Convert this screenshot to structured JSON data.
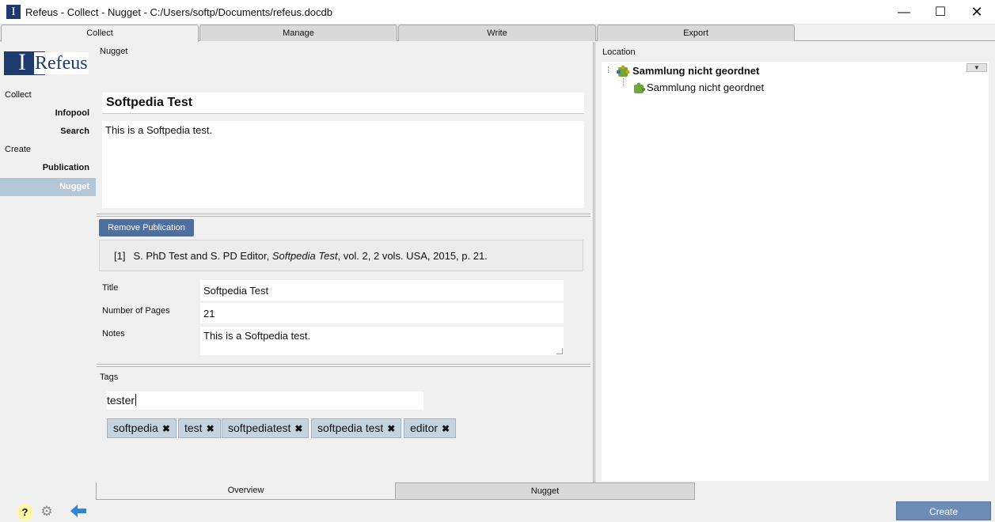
{
  "window": {
    "title": "Refeus - Collect - Nugget - C:/Users/softp/Documents/refeus.docdb",
    "app_icon": "I",
    "min_symbol": "—",
    "max_symbol": "☐",
    "close_symbol": "✕"
  },
  "top_tabs": [
    "Collect",
    "Manage",
    "Write",
    "Export"
  ],
  "logo": {
    "mark": "I",
    "word": "Refeus"
  },
  "nav": {
    "collect_label": "Collect",
    "infopool": "Infopool",
    "search": "Search",
    "create_label": "Create",
    "publication": "Publication",
    "nugget": "Nugget"
  },
  "nugget": {
    "section_label": "Nugget",
    "title": "Softpedia Test",
    "body": "This is a Softpedia test."
  },
  "publication": {
    "remove_button": "Remove Publication",
    "citation": {
      "num": "[1]",
      "pre": "S. PhD Test and S. PD Editor, ",
      "italic": "Softpedia Test",
      "post": ", vol. 2, 2 vols. USA, 2015, p. 21."
    },
    "fields": {
      "title_label": "Title",
      "title_value": "Softpedia Test",
      "pages_label": "Number of Pages",
      "pages_value": "21",
      "notes_label": "Notes",
      "notes_value": "This is a Softpedia test."
    }
  },
  "tags": {
    "label": "Tags",
    "input_value": "tester",
    "items": [
      "softpedia",
      "test",
      "softpediatest",
      "softpedia test",
      "editor"
    ],
    "remove_symbol": "✖"
  },
  "location": {
    "label": "Location",
    "root": "Sammlung nicht geordnet",
    "child": "Sammlung nicht geordnet",
    "dropdown_symbol": "▼"
  },
  "bottom_tabs": [
    "Overview",
    "Nugget"
  ],
  "footer": {
    "help_symbol": "?",
    "gear_symbol": "⚙",
    "create_button": "Create"
  },
  "colors": {
    "brand": "#1e3a6e",
    "nav_selected": "#b4c7d7",
    "tag_bg": "#c5d3df",
    "remove_button": "#4f6f9e",
    "create_button": "#6d8cb6",
    "back_arrow": "#2f86d6"
  }
}
